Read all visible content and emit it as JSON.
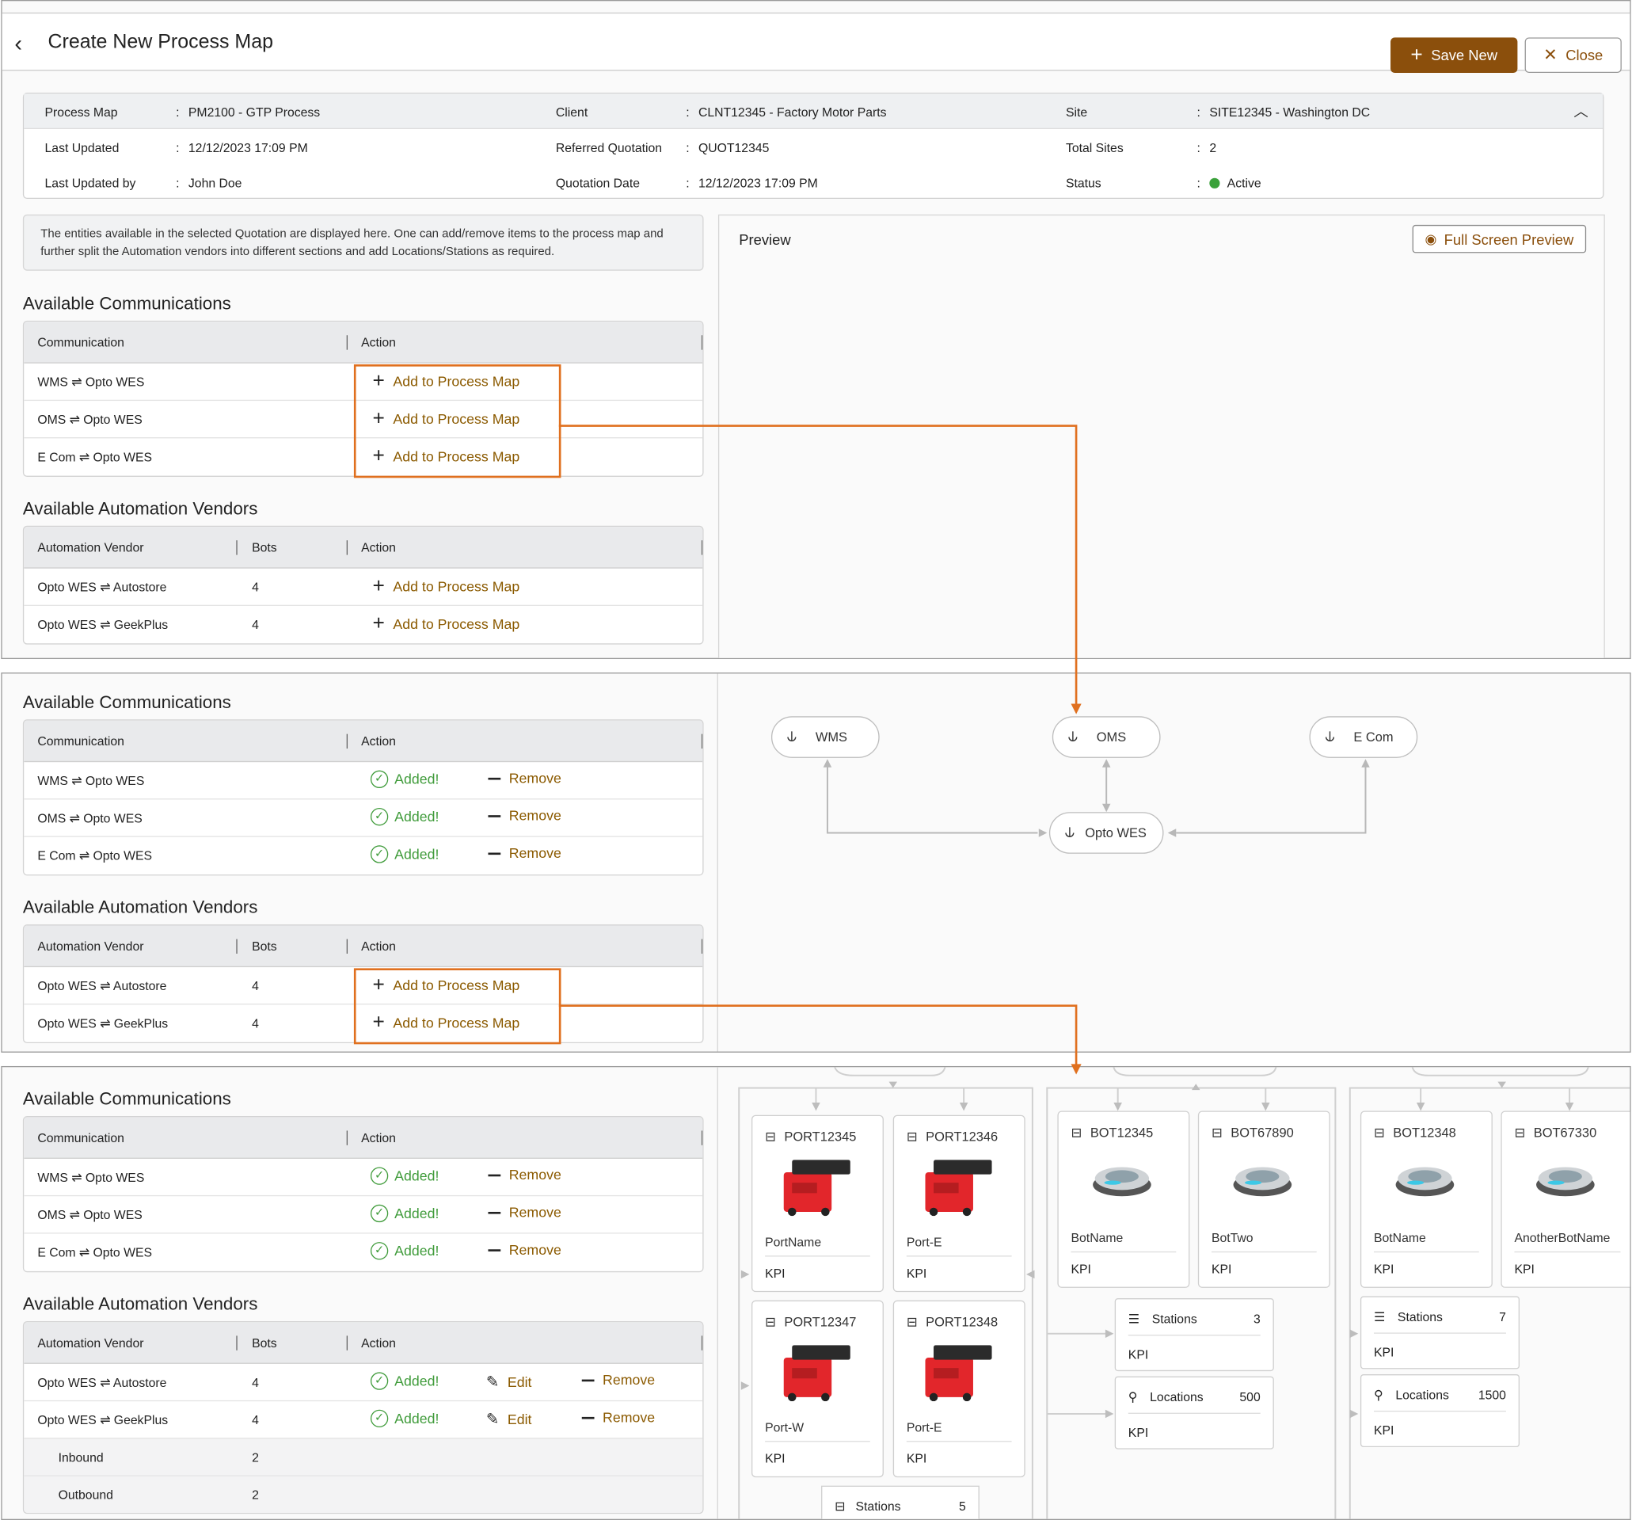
{
  "header": {
    "title": "Create New Process Map",
    "save_label": "Save New",
    "close_label": "Close"
  },
  "details": {
    "col1": [
      {
        "label": "Process Map",
        "value": "PM2100 - GTP Process"
      },
      {
        "label": "Last Updated",
        "value": "12/12/2023 17:09 PM"
      },
      {
        "label": "Last Updated by",
        "value": "John Doe"
      }
    ],
    "col2": [
      {
        "label": "Client",
        "value": "CLNT12345 - Factory Motor Parts"
      },
      {
        "label": "Referred Quotation",
        "value": "QUOT12345"
      },
      {
        "label": "Quotation Date",
        "value": "12/12/2023 17:09 PM"
      }
    ],
    "col3": [
      {
        "label": "Site",
        "value": "SITE12345 - Washington DC"
      },
      {
        "label": "Total Sites",
        "value": "2"
      },
      {
        "label": "Status",
        "value": "Active"
      }
    ],
    "status_color": "#3aa13a"
  },
  "notice": "The entities available in the selected Quotation are displayed here. One can add/remove items to the process map and further split the Automation vendors into different sections and add Locations/Stations as required.",
  "preview": {
    "title": "Preview",
    "fullscreen_label": "Full Screen Preview"
  },
  "sections": {
    "communications": "Available Communications",
    "vendors": "Available Automation Vendors"
  },
  "tables": {
    "comm_headers": {
      "communication": "Communication",
      "action": "Action"
    },
    "vendor_headers": {
      "vendor": "Automation Vendor",
      "bots": "Bots",
      "action": "Action"
    },
    "communications": [
      "WMS ⇌ Opto WES",
      "OMS ⇌ Opto WES",
      "E Com ⇌ Opto WES"
    ],
    "vendors": [
      {
        "name": "Opto WES ⇌ Autostore",
        "bots": "4"
      },
      {
        "name": "Opto WES ⇌ GeekPlus",
        "bots": "4"
      }
    ],
    "subrows": [
      {
        "name": "Inbound",
        "bots": "2"
      },
      {
        "name": "Outbound",
        "bots": "2"
      }
    ]
  },
  "actions": {
    "add": "Add to Process Map",
    "added": "Added!",
    "remove": "Remove",
    "edit": "Edit"
  },
  "diagram": {
    "nodes": {
      "wms": "WMS",
      "oms": "OMS",
      "ecom": "E Com",
      "opto": "Opto WES"
    }
  },
  "cards": {
    "ports": [
      {
        "id": "PORT12345",
        "name": "PortName",
        "kpi": "KPI"
      },
      {
        "id": "PORT12346",
        "name": "Port-E",
        "kpi": "KPI"
      },
      {
        "id": "PORT12347",
        "name": "Port-W",
        "kpi": "KPI"
      },
      {
        "id": "PORT12348",
        "name": "Port-E",
        "kpi": "KPI"
      }
    ],
    "bots": [
      {
        "id": "BOT12345",
        "name": "BotName",
        "kpi": "KPI"
      },
      {
        "id": "BOT67890",
        "name": "BotTwo",
        "kpi": "KPI"
      },
      {
        "id": "BOT12348",
        "name": "BotName",
        "kpi": "KPI"
      },
      {
        "id": "BOT67330",
        "name": "AnotherBotName",
        "kpi": "KPI"
      }
    ],
    "stations": [
      {
        "label": "Stations",
        "value": "3",
        "kpi": "KPI"
      },
      {
        "label": "Locations",
        "value": "500",
        "kpi": "KPI"
      },
      {
        "label": "Stations",
        "value": "7",
        "kpi": "KPI"
      },
      {
        "label": "Locations",
        "value": "1500",
        "kpi": "KPI"
      },
      {
        "label": "Stations",
        "value": "5"
      }
    ]
  },
  "colors": {
    "accent": "#8b4f0c",
    "highlight": "#e0701f",
    "success": "#3f9b3a"
  }
}
